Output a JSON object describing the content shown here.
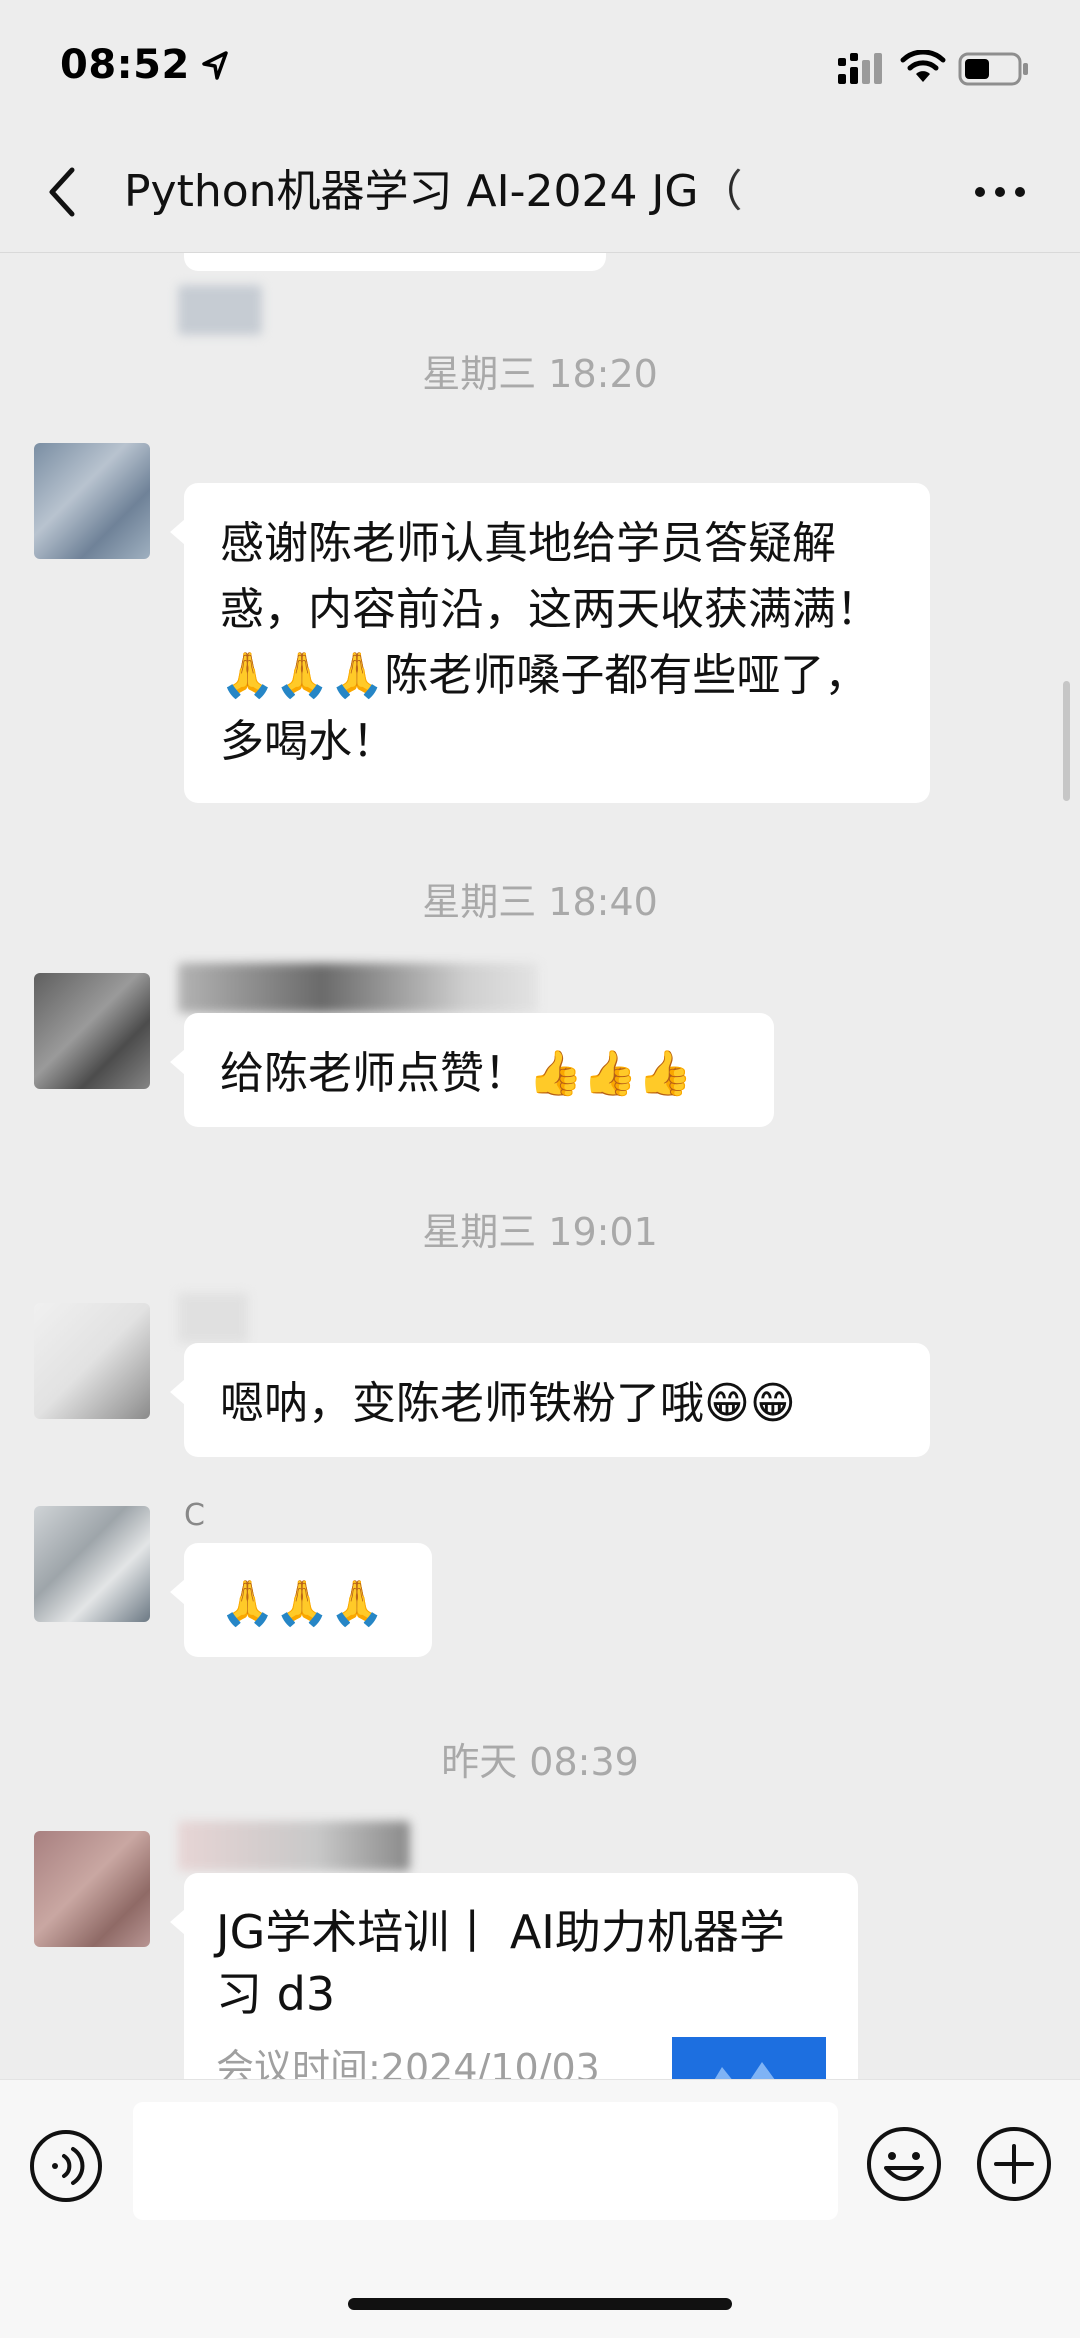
{
  "status_bar": {
    "time": "08:52"
  },
  "header": {
    "title": "Python机器学习 AI-2024 JG（"
  },
  "messages": [
    {
      "timestamp": "星期三 18:20",
      "text": "感谢陈老师认真地给学员答疑解惑，内容前沿，这两天收获满满！",
      "text_tail": "陈老师嗓子都有些哑了，多喝水！",
      "emoji": "🙏🙏🙏"
    },
    {
      "timestamp": "星期三 18:40",
      "text": "给陈老师点赞！",
      "emoji": "👍👍👍"
    },
    {
      "timestamp": "星期三 19:01",
      "text": "嗯呐，变陈老师铁粉了哦",
      "emoji": "😁😁"
    },
    {
      "sender": "C",
      "emoji": "🙏🙏🙏"
    },
    {
      "timestamp": "昨天 08:39",
      "card_title": "JG学术培训丨 AI助力机器学习 d3",
      "card_meta": "会议时间:2024/10/03"
    }
  ],
  "colors": {
    "background": "#ededed",
    "bubble": "#ffffff",
    "timestamp": "#a9a9a9"
  },
  "icons": [
    "location-arrow-icon",
    "signal-icon",
    "wifi-icon",
    "battery-icon",
    "back-chevron-icon",
    "more-dots-icon",
    "voice-icon",
    "emoji-face-icon",
    "plus-circle-icon"
  ]
}
